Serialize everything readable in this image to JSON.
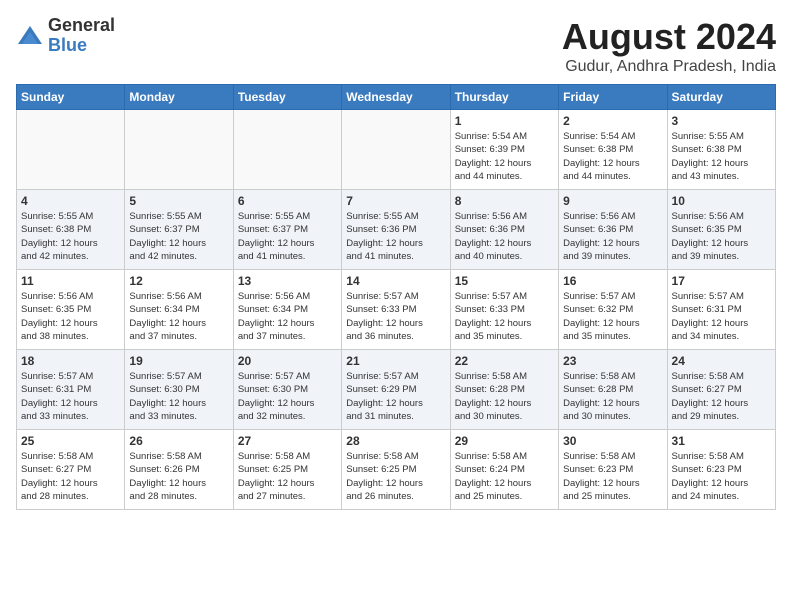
{
  "header": {
    "logo_general": "General",
    "logo_blue": "Blue",
    "title": "August 2024",
    "subtitle": "Gudur, Andhra Pradesh, India"
  },
  "weekdays": [
    "Sunday",
    "Monday",
    "Tuesday",
    "Wednesday",
    "Thursday",
    "Friday",
    "Saturday"
  ],
  "weeks": [
    [
      {
        "day": "",
        "info": ""
      },
      {
        "day": "",
        "info": ""
      },
      {
        "day": "",
        "info": ""
      },
      {
        "day": "",
        "info": ""
      },
      {
        "day": "1",
        "info": "Sunrise: 5:54 AM\nSunset: 6:39 PM\nDaylight: 12 hours\nand 44 minutes."
      },
      {
        "day": "2",
        "info": "Sunrise: 5:54 AM\nSunset: 6:38 PM\nDaylight: 12 hours\nand 44 minutes."
      },
      {
        "day": "3",
        "info": "Sunrise: 5:55 AM\nSunset: 6:38 PM\nDaylight: 12 hours\nand 43 minutes."
      }
    ],
    [
      {
        "day": "4",
        "info": "Sunrise: 5:55 AM\nSunset: 6:38 PM\nDaylight: 12 hours\nand 42 minutes."
      },
      {
        "day": "5",
        "info": "Sunrise: 5:55 AM\nSunset: 6:37 PM\nDaylight: 12 hours\nand 42 minutes."
      },
      {
        "day": "6",
        "info": "Sunrise: 5:55 AM\nSunset: 6:37 PM\nDaylight: 12 hours\nand 41 minutes."
      },
      {
        "day": "7",
        "info": "Sunrise: 5:55 AM\nSunset: 6:36 PM\nDaylight: 12 hours\nand 41 minutes."
      },
      {
        "day": "8",
        "info": "Sunrise: 5:56 AM\nSunset: 6:36 PM\nDaylight: 12 hours\nand 40 minutes."
      },
      {
        "day": "9",
        "info": "Sunrise: 5:56 AM\nSunset: 6:36 PM\nDaylight: 12 hours\nand 39 minutes."
      },
      {
        "day": "10",
        "info": "Sunrise: 5:56 AM\nSunset: 6:35 PM\nDaylight: 12 hours\nand 39 minutes."
      }
    ],
    [
      {
        "day": "11",
        "info": "Sunrise: 5:56 AM\nSunset: 6:35 PM\nDaylight: 12 hours\nand 38 minutes."
      },
      {
        "day": "12",
        "info": "Sunrise: 5:56 AM\nSunset: 6:34 PM\nDaylight: 12 hours\nand 37 minutes."
      },
      {
        "day": "13",
        "info": "Sunrise: 5:56 AM\nSunset: 6:34 PM\nDaylight: 12 hours\nand 37 minutes."
      },
      {
        "day": "14",
        "info": "Sunrise: 5:57 AM\nSunset: 6:33 PM\nDaylight: 12 hours\nand 36 minutes."
      },
      {
        "day": "15",
        "info": "Sunrise: 5:57 AM\nSunset: 6:33 PM\nDaylight: 12 hours\nand 35 minutes."
      },
      {
        "day": "16",
        "info": "Sunrise: 5:57 AM\nSunset: 6:32 PM\nDaylight: 12 hours\nand 35 minutes."
      },
      {
        "day": "17",
        "info": "Sunrise: 5:57 AM\nSunset: 6:31 PM\nDaylight: 12 hours\nand 34 minutes."
      }
    ],
    [
      {
        "day": "18",
        "info": "Sunrise: 5:57 AM\nSunset: 6:31 PM\nDaylight: 12 hours\nand 33 minutes."
      },
      {
        "day": "19",
        "info": "Sunrise: 5:57 AM\nSunset: 6:30 PM\nDaylight: 12 hours\nand 33 minutes."
      },
      {
        "day": "20",
        "info": "Sunrise: 5:57 AM\nSunset: 6:30 PM\nDaylight: 12 hours\nand 32 minutes."
      },
      {
        "day": "21",
        "info": "Sunrise: 5:57 AM\nSunset: 6:29 PM\nDaylight: 12 hours\nand 31 minutes."
      },
      {
        "day": "22",
        "info": "Sunrise: 5:58 AM\nSunset: 6:28 PM\nDaylight: 12 hours\nand 30 minutes."
      },
      {
        "day": "23",
        "info": "Sunrise: 5:58 AM\nSunset: 6:28 PM\nDaylight: 12 hours\nand 30 minutes."
      },
      {
        "day": "24",
        "info": "Sunrise: 5:58 AM\nSunset: 6:27 PM\nDaylight: 12 hours\nand 29 minutes."
      }
    ],
    [
      {
        "day": "25",
        "info": "Sunrise: 5:58 AM\nSunset: 6:27 PM\nDaylight: 12 hours\nand 28 minutes."
      },
      {
        "day": "26",
        "info": "Sunrise: 5:58 AM\nSunset: 6:26 PM\nDaylight: 12 hours\nand 28 minutes."
      },
      {
        "day": "27",
        "info": "Sunrise: 5:58 AM\nSunset: 6:25 PM\nDaylight: 12 hours\nand 27 minutes."
      },
      {
        "day": "28",
        "info": "Sunrise: 5:58 AM\nSunset: 6:25 PM\nDaylight: 12 hours\nand 26 minutes."
      },
      {
        "day": "29",
        "info": "Sunrise: 5:58 AM\nSunset: 6:24 PM\nDaylight: 12 hours\nand 25 minutes."
      },
      {
        "day": "30",
        "info": "Sunrise: 5:58 AM\nSunset: 6:23 PM\nDaylight: 12 hours\nand 25 minutes."
      },
      {
        "day": "31",
        "info": "Sunrise: 5:58 AM\nSunset: 6:23 PM\nDaylight: 12 hours\nand 24 minutes."
      }
    ]
  ]
}
